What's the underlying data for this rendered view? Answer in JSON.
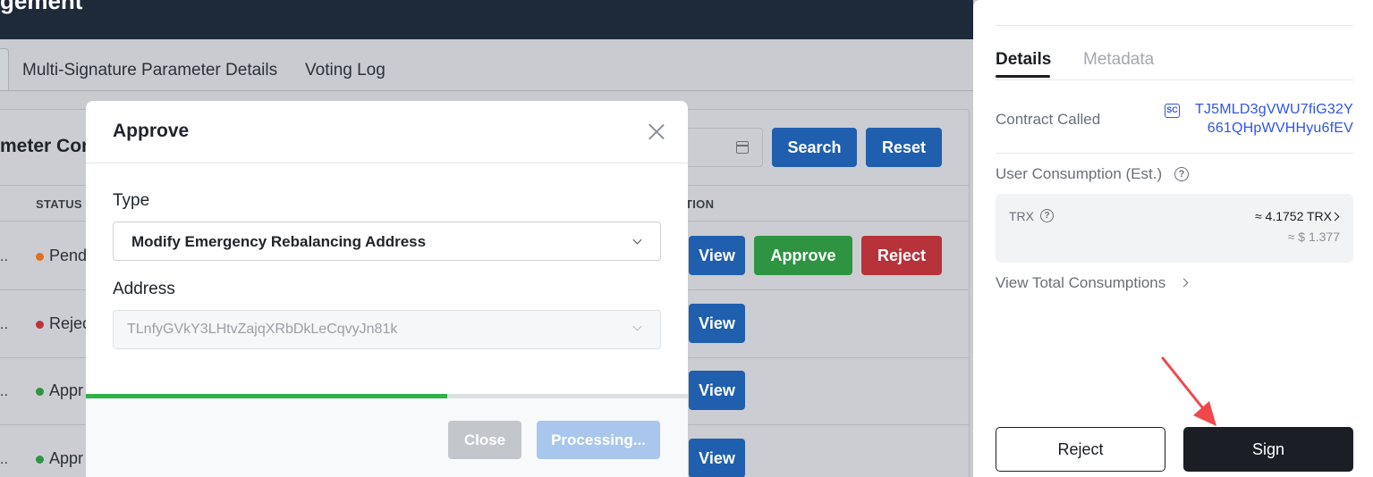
{
  "header": {
    "title": "gement"
  },
  "tabs": [
    {
      "label": "Multi-Signature Parameter Details"
    },
    {
      "label": "Voting Log"
    }
  ],
  "section": {
    "title": "meter Conf"
  },
  "toolbar": {
    "search_label": "Search",
    "reset_label": "Reset"
  },
  "table": {
    "headers": {
      "status": "STATUS",
      "action": "TION"
    },
    "rows": [
      {
        "ellipsis": "..",
        "status": "Pend",
        "status_color": "#e07020",
        "actions": [
          "View",
          "Approve",
          "Reject"
        ]
      },
      {
        "ellipsis": "..",
        "status": "Rejec",
        "status_color": "#c0323a",
        "actions": [
          "View"
        ]
      },
      {
        "ellipsis": "..",
        "status": "Appr",
        "status_color": "#2e9441",
        "actions": [
          "View"
        ]
      },
      {
        "ellipsis": "..",
        "status": "Appr",
        "status_color": "#2e9441",
        "actions": [
          "View"
        ]
      }
    ]
  },
  "modal": {
    "title": "Approve",
    "type_label": "Type",
    "type_value": "Modify Emergency Rebalancing Address",
    "address_label": "Address",
    "address_value": "TLnfyGVkY3LHtvZajqXRbDkLeCqvyJn81k",
    "progress": 0.6,
    "close_label": "Close",
    "processing_label": "Processing..."
  },
  "wallet": {
    "tabs": {
      "details": "Details",
      "metadata": "Metadata"
    },
    "contract_called_label": "Contract Called",
    "contract_badge": "SC",
    "contract_address_line1": "TJ5MLD3gVWU7fiG32Y",
    "contract_address_line2": "661QHpWVHHyu6fEV",
    "user_consumption_label": "User Consumption (Est.)",
    "trx_label": "TRX",
    "trx_value": "≈ 4.1752 TRX",
    "usd_value": "≈ $ 1.377",
    "view_total_label": "View Total Consumptions",
    "reject_label": "Reject",
    "sign_label": "Sign"
  },
  "colors": {
    "accent_blue": "#2f54eb",
    "progress_green": "#2fb14a",
    "arrow_red": "#f0474b"
  }
}
